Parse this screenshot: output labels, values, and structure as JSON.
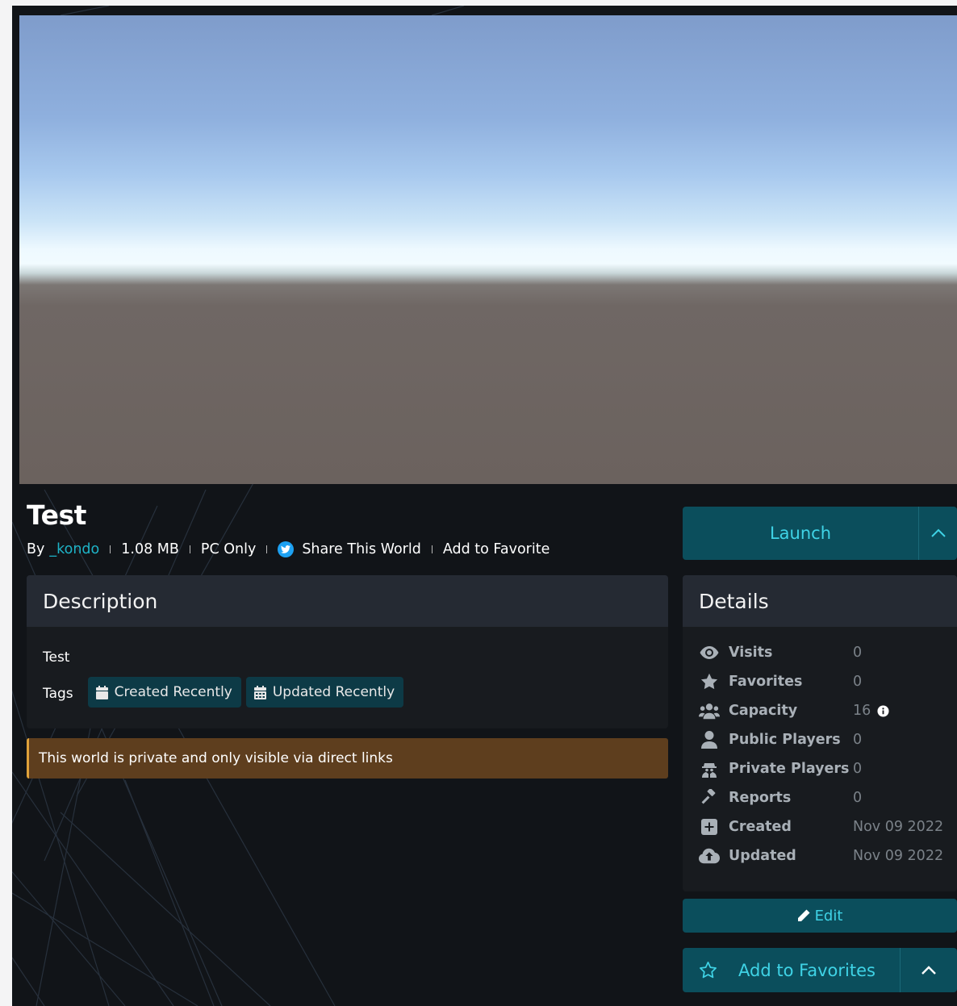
{
  "world": {
    "title": "Test",
    "by_label": "By",
    "author": "_kondo",
    "size": "1.08 MB",
    "platform": "PC Only",
    "share_label": "Share This World",
    "favorite_link_label": "Add to Favorite"
  },
  "description": {
    "heading": "Description",
    "text": "Test",
    "tags_label": "Tags",
    "tags": [
      {
        "label": "Created Recently",
        "icon": "calendar-icon"
      },
      {
        "label": "Updated Recently",
        "icon": "calendar-week-icon"
      }
    ]
  },
  "private_notice": "This world is private and only visible via direct links",
  "launch": {
    "label": "Launch"
  },
  "details": {
    "heading": "Details",
    "rows": [
      {
        "label": "Visits",
        "value": "0",
        "icon": "eye-icon"
      },
      {
        "label": "Favorites",
        "value": "0",
        "icon": "star-icon"
      },
      {
        "label": "Capacity",
        "value": "16",
        "icon": "users-icon"
      },
      {
        "label": "Public Players",
        "value": "0",
        "icon": "user-icon"
      },
      {
        "label": "Private Players",
        "value": "0",
        "icon": "user-secret-icon"
      },
      {
        "label": "Reports",
        "value": "0",
        "icon": "gavel-icon"
      },
      {
        "label": "Created",
        "value": "Nov 09 2022",
        "icon": "plus-square-icon"
      },
      {
        "label": "Updated",
        "value": "Nov 09 2022",
        "icon": "cloud-upload-icon"
      }
    ]
  },
  "edit": {
    "label": "Edit"
  },
  "favorites_button": {
    "label": "Add to Favorites"
  },
  "colors": {
    "accent": "#3fd3e6",
    "link": "#1eb3c7",
    "button_bg": "#0b4e5c",
    "panel_bg": "#181b1f",
    "panel_head_bg": "#252a33",
    "warning_bg": "#5e3e1e",
    "warning_border": "#e0a23a"
  }
}
